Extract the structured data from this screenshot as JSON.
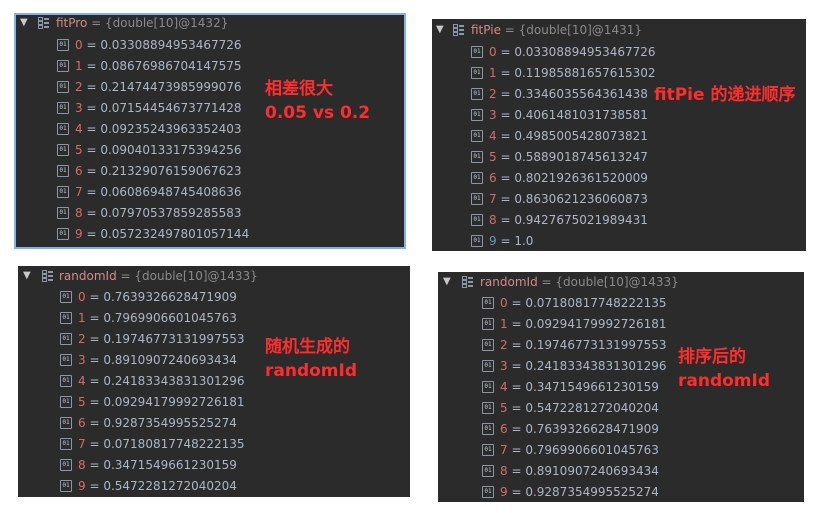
{
  "panels": [
    {
      "var_name": "fitPro",
      "type_text": " = {double[10]@1432}",
      "items": [
        {
          "index": "0",
          "value": "0.03308894953467726"
        },
        {
          "index": "1",
          "value": "0.08676986704147575"
        },
        {
          "index": "2",
          "value": "0.21474473985999076"
        },
        {
          "index": "3",
          "value": "0.07154454673771428"
        },
        {
          "index": "4",
          "value": "0.09235243963352403"
        },
        {
          "index": "5",
          "value": "0.09040133175394256"
        },
        {
          "index": "6",
          "value": "0.21329076159067623"
        },
        {
          "index": "7",
          "value": "0.06086948745408636"
        },
        {
          "index": "8",
          "value": "0.07970537859285583"
        },
        {
          "index": "9",
          "value": "0.057232497801057144"
        }
      ],
      "annotation": [
        "相差很大",
        "0.05  vs  0.2"
      ]
    },
    {
      "var_name": "fitPie",
      "type_text": " = {double[10]@1431}",
      "items": [
        {
          "index": "0",
          "value": "0.03308894953467726"
        },
        {
          "index": "1",
          "value": "0.11985881657615302"
        },
        {
          "index": "2",
          "value": "0.3346035564361438"
        },
        {
          "index": "3",
          "value": "0.4061481031738581"
        },
        {
          "index": "4",
          "value": "0.4985005428073821"
        },
        {
          "index": "5",
          "value": "0.5889018745613247"
        },
        {
          "index": "6",
          "value": "0.8021926361520009"
        },
        {
          "index": "7",
          "value": "0.8630621236060873"
        },
        {
          "index": "8",
          "value": "0.9427675021989431"
        },
        {
          "index": "9",
          "value": "1.0"
        }
      ],
      "annotation": [
        "fitPie 的递进顺序"
      ]
    },
    {
      "var_name": "randomId",
      "type_text": " = {double[10]@1433}",
      "items": [
        {
          "index": "0",
          "value": "0.7639326628471909"
        },
        {
          "index": "1",
          "value": "0.7969906601045763"
        },
        {
          "index": "2",
          "value": "0.19746773131997553"
        },
        {
          "index": "3",
          "value": "0.8910907240693434"
        },
        {
          "index": "4",
          "value": "0.24183343831301296"
        },
        {
          "index": "5",
          "value": "0.09294179992726181"
        },
        {
          "index": "6",
          "value": "0.9287354995525274"
        },
        {
          "index": "7",
          "value": "0.07180817748222135"
        },
        {
          "index": "8",
          "value": "0.3471549661230159"
        },
        {
          "index": "9",
          "value": "0.5472281272040204"
        }
      ],
      "annotation": [
        "随机生成的",
        "randomId"
      ]
    },
    {
      "var_name": "randomId",
      "type_text": " = {double[10]@1433}",
      "items": [
        {
          "index": "0",
          "value": "0.07180817748222135"
        },
        {
          "index": "1",
          "value": "0.09294179992726181"
        },
        {
          "index": "2",
          "value": "0.19746773131997553"
        },
        {
          "index": "3",
          "value": "0.24183343831301296"
        },
        {
          "index": "4",
          "value": "0.3471549661230159"
        },
        {
          "index": "5",
          "value": "0.5472281272040204"
        },
        {
          "index": "6",
          "value": "0.7639326628471909"
        },
        {
          "index": "7",
          "value": "0.7969906601045763"
        },
        {
          "index": "8",
          "value": "0.8910907240693434"
        },
        {
          "index": "9",
          "value": "0.9287354995525274"
        }
      ],
      "annotation": [
        "排序后的",
        "randomId"
      ]
    }
  ],
  "icons": {
    "expand": "triangle-down-icon",
    "array": "array-icon",
    "element": "array-element-icon"
  },
  "index_icon_glyph": "01",
  "colors": {
    "panel_bg": "#2b2b2b",
    "var_name": "#d28a8a",
    "index": "#d56b6b",
    "last_index_fitPie": "#6897bb",
    "annotation": "#ff2d2d",
    "selection_border": "#7fb3f0"
  }
}
